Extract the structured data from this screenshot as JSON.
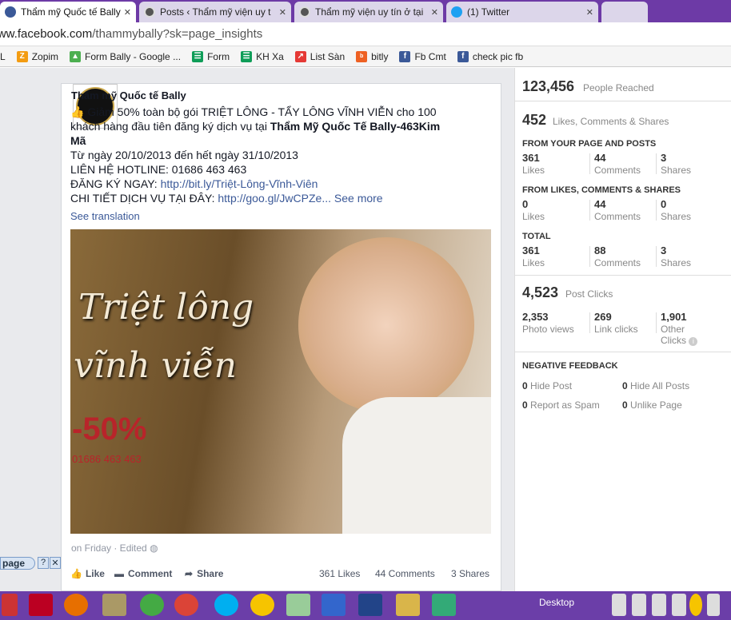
{
  "browser": {
    "tabs": [
      {
        "label": "Thẩm mỹ Quốc tế Bally"
      },
      {
        "label": "Posts ‹ Thẩm mỹ viện uy t"
      },
      {
        "label": "Thẩm mỹ viện uy tín ở tại"
      },
      {
        "label": "(1) Twitter"
      }
    ],
    "url_host": "www.facebook.com",
    "url_path": "/thammybally?sk=page_insights",
    "bookmarks": [
      "L",
      "Zopim",
      "Form Bally - Google ...",
      "Form",
      "KH Xa",
      "List Sàn",
      "bitly",
      "Fb Cmt",
      "check pic fb"
    ]
  },
  "post": {
    "page_name": "Thẩm mỹ Quốc tế Bally",
    "line1": "Giảm 50% toàn bộ gói TRIỆT LÔNG - TẨY LÔNG VĨNH VIỄN cho 100",
    "line2a": "khách hàng đầu tiên đăng ký dịch vụ tại",
    "line2b": "Thẩm Mỹ Quốc Tế Bally-463Kim",
    "line3": "Mã",
    "line4": "Từ ngày 20/10/2013 đến hết ngày 31/10/2013",
    "line5": "LIÊN HỆ HOTLINE: 01686 463 463",
    "line6a": "ĐĂNG KÝ NGAY:",
    "line6b": "http://bit.ly/Triệt-Lông-Vĩnh-Viên",
    "line7a": "CHI TIẾT DỊCH VỤ TẠI ĐÂY:",
    "line7b": "http://goo.gl/JwCPZe...",
    "see_more": "See more",
    "see_translation": "See translation",
    "image_text1": "Triệt lông",
    "image_text2": "vĩnh viễn",
    "image_text3": "-50%",
    "image_text4": "01686 463 463",
    "meta": "on Friday · Edited",
    "like": "Like",
    "comment": "Comment",
    "share": "Share",
    "likes_count": "361 Likes",
    "comments_count": "44 Comments",
    "shares_count": "3 Shares"
  },
  "insights": {
    "reached_num": "123,456",
    "reached_label": "People Reached",
    "lcs_num": "452",
    "lcs_label": "Likes, Comments & Shares",
    "sec1": "FROM YOUR PAGE AND POSTS",
    "sec2": "FROM LIKES, COMMENTS & SHARES",
    "sec3": "TOTAL",
    "r1": [
      "361",
      "44",
      "3"
    ],
    "r2": [
      "0",
      "44",
      "0"
    ],
    "r3": [
      "361",
      "88",
      "3"
    ],
    "lbl_likes": "Likes",
    "lbl_comments": "Comments",
    "lbl_shares": "Shares",
    "clicks_num": "4,523",
    "clicks_label": "Post Clicks",
    "photo_views_num": "2,353",
    "photo_views": "Photo views",
    "link_clicks_num": "269",
    "link_clicks": "Link clicks",
    "other_num": "1,901",
    "other1": "Other",
    "other2": "Clicks",
    "neg": "NEGATIVE FEEDBACK",
    "hide_post_num": "0",
    "hide_post": "Hide Post",
    "hide_all_num": "0",
    "hide_all": "Hide All Posts",
    "spam_num": "0",
    "spam": "Report as Spam",
    "unlike_num": "0",
    "unlike": "Unlike Page"
  },
  "taskbar": {
    "desktop_label": "Desktop",
    "help_label": "page"
  }
}
